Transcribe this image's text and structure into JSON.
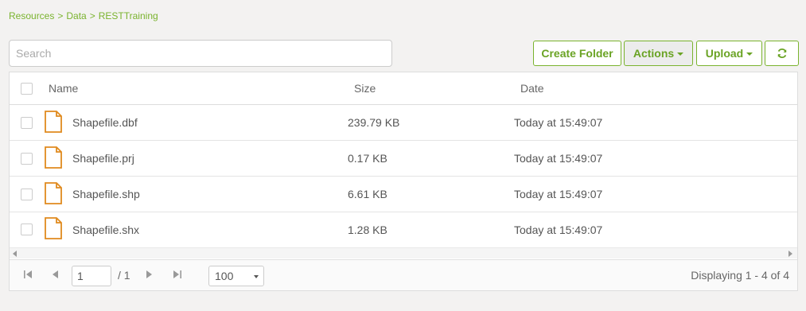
{
  "breadcrumb": {
    "items": [
      "Resources",
      "Data",
      "RESTTraining"
    ],
    "separator": ">"
  },
  "search": {
    "placeholder": "Search",
    "value": ""
  },
  "toolbar": {
    "create_folder": "Create Folder",
    "actions": "Actions",
    "upload": "Upload",
    "refresh_icon": "refresh-icon"
  },
  "table": {
    "columns": {
      "name": "Name",
      "size": "Size",
      "date": "Date"
    },
    "rows": [
      {
        "name": "Shapefile.dbf",
        "size": "239.79 KB",
        "date": "Today at 15:49:07"
      },
      {
        "name": "Shapefile.prj",
        "size": "0.17 KB",
        "date": "Today at 15:49:07"
      },
      {
        "name": "Shapefile.shp",
        "size": "6.61 KB",
        "date": "Today at 15:49:07"
      },
      {
        "name": "Shapefile.shx",
        "size": "1.28 KB",
        "date": "Today at 15:49:07"
      }
    ]
  },
  "pager": {
    "page": "1",
    "total": "/ 1",
    "page_size": "100",
    "displaying": "Displaying 1 - 4 of 4"
  },
  "colors": {
    "accent": "#7ab32e",
    "file_icon": "#e08a1e",
    "background": "#f3f2f1"
  }
}
